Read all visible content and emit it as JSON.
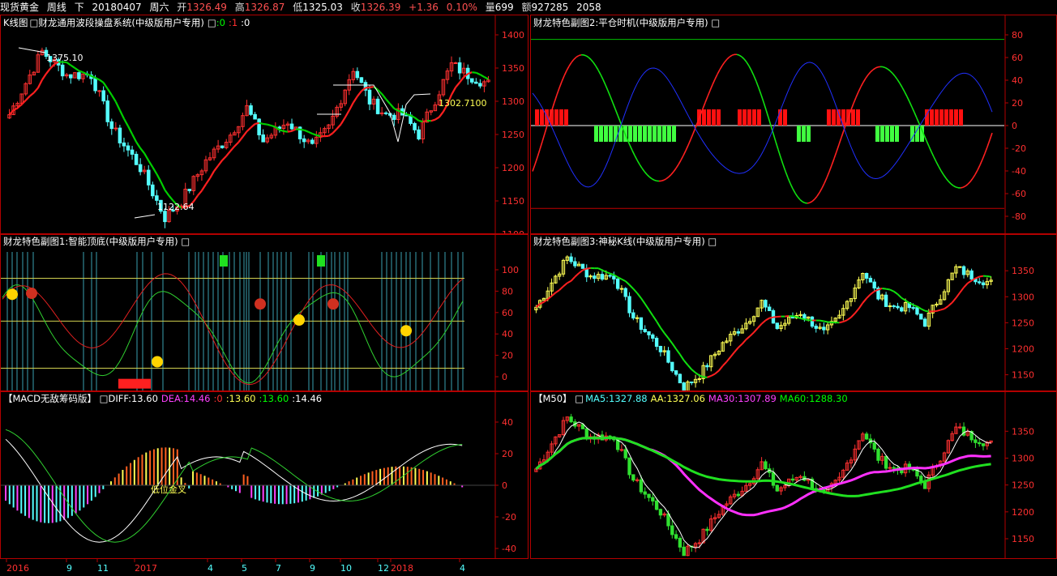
{
  "header": {
    "instrument": "现货黄金",
    "period": "周线",
    "direction": "下",
    "date": "20180407",
    "weekday": "周六",
    "open_label": "开",
    "open": "1326.49",
    "high_label": "高",
    "high": "1326.87",
    "low_label": "低",
    "low": "1325.03",
    "close_label": "收",
    "close": "1326.39",
    "change": "+1.36",
    "change_pct": "0.10%",
    "volume_label": "量",
    "volume": "699",
    "amount_label": "额",
    "amount": "927285",
    "extra": "2058"
  },
  "kline": {
    "title": "K线图",
    "indicator": "□财龙通用波段操盘系统(中级版用户专用)",
    "box": "□",
    "v0": ":0",
    "v1": ":1",
    "v2": ":0",
    "high_label": "1375.10",
    "low_label": "1122.64",
    "last_label": "1302.7100",
    "y_ticks": [
      "1400",
      "1350",
      "1300",
      "1250",
      "1200",
      "1150",
      "1100"
    ]
  },
  "panel2": {
    "title": "财龙特色副图2:平仓时机(中级版用户专用) □",
    "y_ticks": [
      "80",
      "60",
      "40",
      "20",
      "0",
      "-20",
      "-40",
      "-60",
      "-80"
    ]
  },
  "panel1": {
    "title": "财龙特色副图1:智能顶底(中级版用户专用) □",
    "y_ticks": [
      "100",
      "80",
      "60",
      "40",
      "20",
      "0"
    ]
  },
  "panel3": {
    "title": "财龙特色副图3:神秘K线(中级版用户专用) □",
    "y_ticks": [
      "1350",
      "1300",
      "1250",
      "1200",
      "1150"
    ]
  },
  "macd": {
    "title": "【MACD无敌筹码版】 □",
    "diff_label": "DIFF:13.60",
    "dea_label": "DEA:14.46",
    "z_label": ":0",
    "a_label": ":13.60",
    "b_label": ":13.60",
    "c_label": ":14.46",
    "annotation": "低位金叉",
    "y_ticks": [
      "40",
      "20",
      "0",
      "-20",
      "-40"
    ]
  },
  "m50": {
    "title": "【M50】 □",
    "ma5": "MA5:1327.88",
    "aa": "AA:1327.06",
    "ma30": "MA30:1307.89",
    "ma60": "MA60:1288.30",
    "y_ticks": [
      "1350",
      "1300",
      "1250",
      "1200",
      "1150"
    ]
  },
  "xaxis": {
    "labels": [
      "2016",
      "9",
      "11",
      "2017",
      "4",
      "5",
      "7",
      "9",
      "10",
      "12",
      "2018",
      "4"
    ]
  },
  "colors": {
    "up": "#ff3030",
    "down": "#54ffff",
    "yellow": "#ffff54",
    "green": "#00e000",
    "magenta": "#ff40ff",
    "frame": "#b30000"
  }
}
